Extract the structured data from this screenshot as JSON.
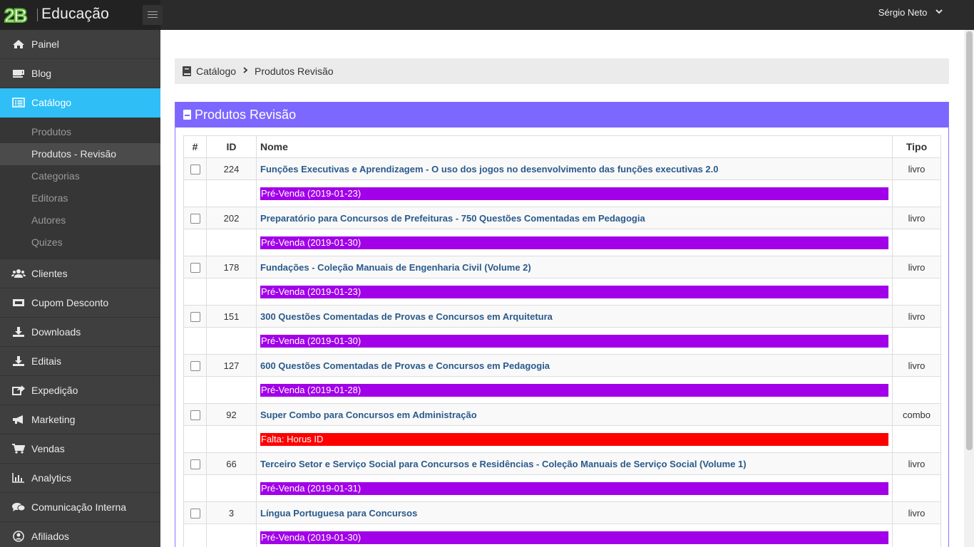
{
  "app": {
    "logo_mark": "2B",
    "logo_text": "Educação",
    "user_name": "Sérgio Neto"
  },
  "sidebar": {
    "items": [
      {
        "label": "Painel",
        "icon": "home-icon",
        "active": false
      },
      {
        "label": "Blog",
        "icon": "coffee-icon",
        "active": false
      },
      {
        "label": "Catálogo",
        "icon": "list-alt-icon",
        "active": true,
        "subitems": [
          {
            "label": "Produtos",
            "active": false
          },
          {
            "label": "Produtos - Revisão",
            "active": true
          },
          {
            "label": "Categorias",
            "active": false
          },
          {
            "label": "Editoras",
            "active": false
          },
          {
            "label": "Autores",
            "active": false
          },
          {
            "label": "Quizes",
            "active": false
          }
        ]
      },
      {
        "label": "Clientes",
        "icon": "users-icon",
        "active": false
      },
      {
        "label": "Cupom Desconto",
        "icon": "ticket-icon",
        "active": false
      },
      {
        "label": "Downloads",
        "icon": "download-icon",
        "active": false
      },
      {
        "label": "Editais",
        "icon": "download-icon",
        "active": false
      },
      {
        "label": "Expedição",
        "icon": "share-icon",
        "active": false
      },
      {
        "label": "Marketing",
        "icon": "bullhorn-icon",
        "active": false
      },
      {
        "label": "Vendas",
        "icon": "cart-icon",
        "active": false
      },
      {
        "label": "Analytics",
        "icon": "bar-chart-icon",
        "active": false
      },
      {
        "label": "Comunicação Interna",
        "icon": "comments-icon",
        "active": false
      },
      {
        "label": "Afiliados",
        "icon": "user-circle-icon",
        "active": false
      }
    ]
  },
  "breadcrumb": {
    "root": "Catálogo",
    "current": "Produtos Revisão"
  },
  "panel": {
    "title": "Produtos Revisão"
  },
  "table": {
    "headers": {
      "check": "#",
      "id": "ID",
      "nome": "Nome",
      "tipo": "Tipo"
    },
    "rows": [
      {
        "id": "224",
        "nome": "Funções Executivas e Aprendizagem - O uso dos jogos no desenvolvimento das funções executivas 2.0",
        "tipo": "livro",
        "tag": "Pré-Venda (2019-01-23)",
        "tag_color": "#a100e8"
      },
      {
        "id": "202",
        "nome": "Preparatório para Concursos de Prefeituras - 750 Questões Comentadas em Pedagogia",
        "tipo": "livro",
        "tag": "Pré-Venda (2019-01-30)",
        "tag_color": "#a100e8"
      },
      {
        "id": "178",
        "nome": "Fundações - Coleção Manuais de Engenharia Civil (Volume 2)",
        "tipo": "livro",
        "tag": "Pré-Venda (2019-01-23)",
        "tag_color": "#a100e8"
      },
      {
        "id": "151",
        "nome": "300 Questões Comentadas de Provas e Concursos em Arquitetura",
        "tipo": "livro",
        "tag": "Pré-Venda (2019-01-30)",
        "tag_color": "#a100e8"
      },
      {
        "id": "127",
        "nome": "600 Questões Comentadas de Provas e Concursos em Pedagogia",
        "tipo": "livro",
        "tag": "Pré-Venda (2019-01-28)",
        "tag_color": "#a100e8"
      },
      {
        "id": "92",
        "nome": "Super Combo para Concursos em Administração",
        "tipo": "combo",
        "tag": "Falta: Horus ID",
        "tag_color": "#ff0000"
      },
      {
        "id": "66",
        "nome": "Terceiro Setor e Serviço Social para Concursos e Residências - Coleção Manuais de Serviço Social (Volume 1)",
        "tipo": "livro",
        "tag": "Pré-Venda (2019-01-31)",
        "tag_color": "#a100e8"
      },
      {
        "id": "3",
        "nome": "Língua Portuguesa para Concursos",
        "tipo": "livro",
        "tag": "Pré-Venda (2019-01-30)",
        "tag_color": "#a100e8"
      }
    ]
  },
  "colors": {
    "accent": "#2fbff6",
    "panel_header": "#7c67ff",
    "presale_tag": "#a100e8",
    "missing_tag": "#ff0000"
  }
}
